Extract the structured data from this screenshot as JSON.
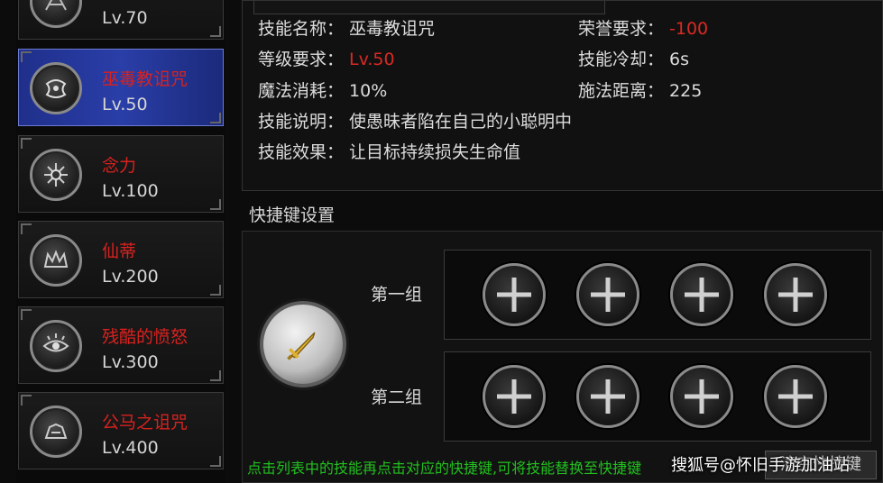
{
  "skills": [
    {
      "name": "",
      "level": "Lv.70",
      "selected": false,
      "name_color": "#d8221f"
    },
    {
      "name": "巫毒教诅咒",
      "level": "Lv.50",
      "selected": true,
      "name_color": "#d8221f"
    },
    {
      "name": "念力",
      "level": "Lv.100",
      "selected": false,
      "name_color": "#d8221f"
    },
    {
      "name": "仙蒂",
      "level": "Lv.200",
      "selected": false,
      "name_color": "#d8221f"
    },
    {
      "name": "残酷的愤怒",
      "level": "Lv.300",
      "selected": false,
      "name_color": "#d8221f"
    },
    {
      "name": "公马之诅咒",
      "level": "Lv.400",
      "selected": false,
      "name_color": "#d8221f"
    }
  ],
  "info": {
    "skill_name_label": "技能名称：",
    "skill_name_value": "巫毒教诅咒",
    "honor_label": "荣誉要求：",
    "honor_value": "-100",
    "level_req_label": "等级要求：",
    "level_req_value": "Lv.50",
    "cooldown_label": "技能冷却：",
    "cooldown_value": "6s",
    "mana_label": "魔法消耗：",
    "mana_value": "10%",
    "range_label": "施法距离：",
    "range_value": "225",
    "desc_label": "技能说明：",
    "desc_value": "使愚昧者陷在自己的小聪明中",
    "effect_label": "技能效果：",
    "effect_value": "让目标持续损失生命值"
  },
  "shortcut": {
    "title": "快捷键设置",
    "group1_label": "第一组",
    "group2_label": "第二组",
    "hint": "点击列表中的技能再点击对应的快捷键,可将技能替换至快捷键",
    "clear_button": "清空快捷键"
  },
  "watermark": "搜狐号@怀旧手游加油站",
  "colors": {
    "accent_red": "#d92a22",
    "hint_green": "#22c01f",
    "selected_bg": "#2a3ea8"
  }
}
